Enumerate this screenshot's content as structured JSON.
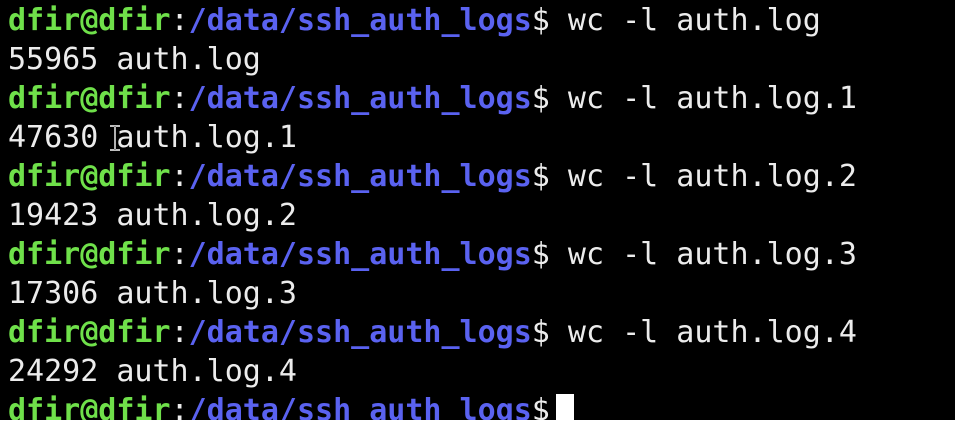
{
  "terminal": {
    "colors": {
      "background": "#000000",
      "user": "#6fe04a",
      "path": "#5a62f0",
      "text": "#ececec"
    },
    "lines": [
      {
        "type": "prompt",
        "user": "dfir@dfir",
        "sep": ":",
        "path": "/data/ssh_auth_logs",
        "symbol": "$ ",
        "command": "wc -l auth.log"
      },
      {
        "type": "output",
        "text": "55965 auth.log"
      },
      {
        "type": "prompt",
        "user": "dfir@dfir",
        "sep": ":",
        "path": "/data/ssh_auth_logs",
        "symbol": "$ ",
        "command": "wc -l auth.log.1"
      },
      {
        "type": "output",
        "text": "47630 auth.log.1"
      },
      {
        "type": "prompt",
        "user": "dfir@dfir",
        "sep": ":",
        "path": "/data/ssh_auth_logs",
        "symbol": "$ ",
        "command": "wc -l auth.log.2"
      },
      {
        "type": "output",
        "text": "19423 auth.log.2"
      },
      {
        "type": "prompt",
        "user": "dfir@dfir",
        "sep": ":",
        "path": "/data/ssh_auth_logs",
        "symbol": "$ ",
        "command": "wc -l auth.log.3"
      },
      {
        "type": "output",
        "text": "17306 auth.log.3"
      },
      {
        "type": "prompt",
        "user": "dfir@dfir",
        "sep": ":",
        "path": "/data/ssh_auth_logs",
        "symbol": "$ ",
        "command": "wc -l auth.log.4"
      },
      {
        "type": "output",
        "text": "24292 auth.log.4"
      },
      {
        "type": "prompt",
        "user": "dfir@dfir",
        "sep": ":",
        "path": "/data/ssh_auth_logs",
        "symbol": "$",
        "command": ""
      }
    ],
    "mouse_pointer_icon": "text-ibeam-icon"
  }
}
